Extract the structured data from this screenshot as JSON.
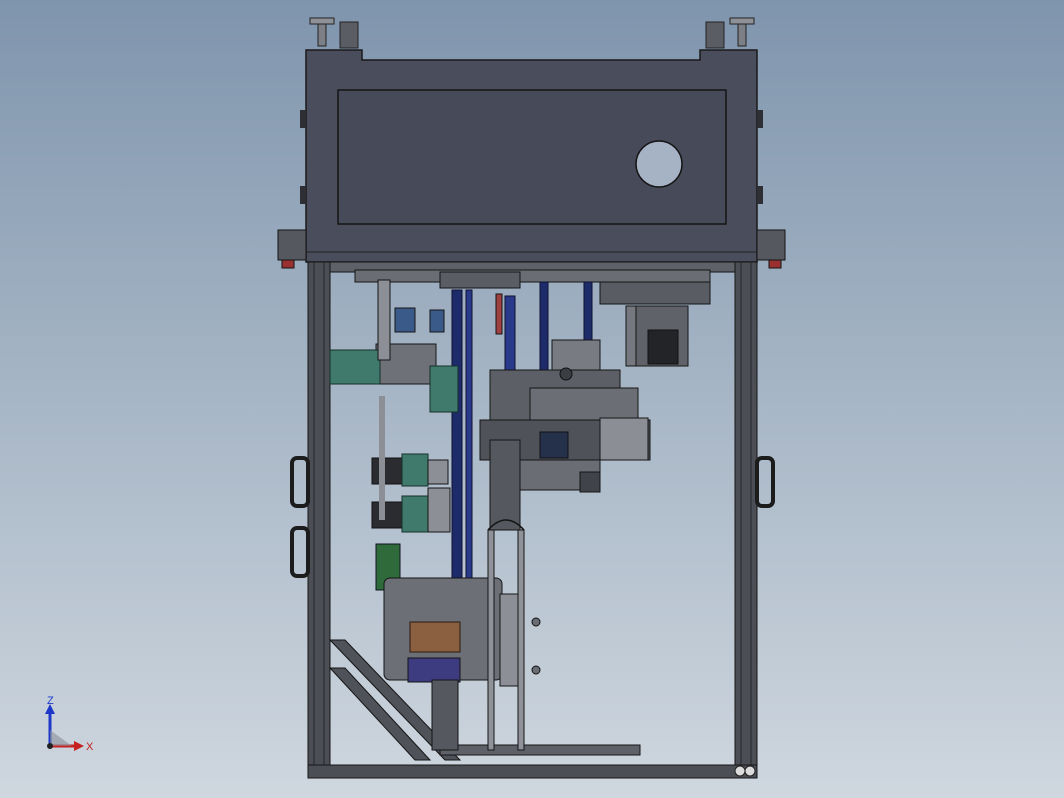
{
  "viewport": {
    "background_top": "#7f95ad",
    "background_bottom": "#cfd7df"
  },
  "triad": {
    "z_label": "Z",
    "x_label": "X",
    "z_color": "#1d38c9",
    "x_color": "#c62020",
    "origin_color": "#202020"
  },
  "model": {
    "body_color": "#4a4d5c",
    "frame_color": "#3c3f45",
    "blue_parts_color": "#1e2b6a",
    "green_parts_color": "#3f7a6c",
    "brown_part_color": "#8a6040"
  }
}
